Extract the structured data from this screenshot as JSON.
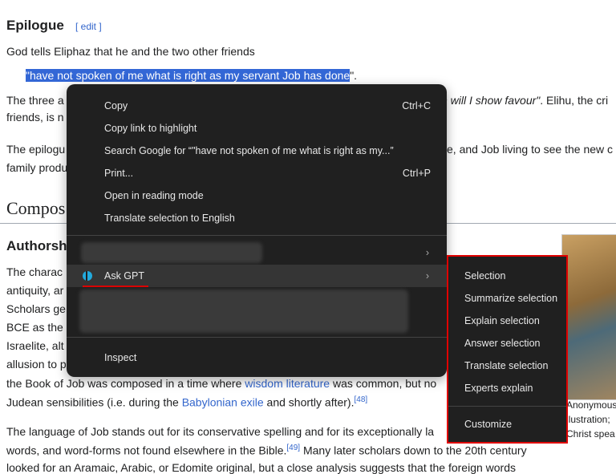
{
  "article": {
    "epilogue_heading": "Epilogue",
    "edit_label": "[ edit ]",
    "p1": "God tells Eliphaz that he and the two other friends",
    "quote": "\"have not spoken of me what is right as my servant Job has done",
    "quote_end": "\".",
    "p2a": "The three a",
    "p2b": "n will I show favour\"",
    "p2c": ". Elihu, the cri",
    "p2d": "friends, is n",
    "p3a": "The epilogu",
    "p3b": "e, and Job living to see the new c",
    "p3c": "family produ",
    "composition_heading": "Compos",
    "authorship_heading": "Authorsh",
    "p4": [
      "The charac",
      "antiquity, ar",
      "Scholars ge",
      "BCE as the",
      "Israelite, alt",
      "allusion to p"
    ],
    "p5a": "the Book of Job was composed in a time where ",
    "p5link": "wisdom literature",
    "p5b": " was common, but no",
    "p6a": "Judean sensibilities (i.e. during the ",
    "p6link": "Babylonian exile",
    "p6b": " and shortly after).",
    "p6ref": "[48]",
    "p7a": "The language of Job stands out for its conservative spelling and for its exceptionally la",
    "p8a": "words, and word-forms not found elsewhere in the Bible.",
    "p8ref": "[49]",
    "p8b": " Many later scholars down to the 20th century",
    "p9": "looked for an Aramaic, Arabic, or Edomite original, but a close analysis suggests that the foreign words",
    "caption": [
      "Anonymous",
      "llustration;",
      "Christ spea"
    ]
  },
  "context_menu": {
    "items": [
      {
        "label": "Copy",
        "shortcut": "Ctrl+C"
      },
      {
        "label": "Copy link to highlight",
        "shortcut": ""
      },
      {
        "label": "Search Google for “\"have not spoken of me what is right as my...”",
        "shortcut": ""
      },
      {
        "label": "Print...",
        "shortcut": "Ctrl+P"
      },
      {
        "label": "Open in reading mode",
        "shortcut": ""
      },
      {
        "label": "Translate selection to English",
        "shortcut": ""
      }
    ],
    "ask_gpt": "Ask GPT",
    "chevron": "›",
    "inspect": "Inspect"
  },
  "submenu": {
    "items": [
      "Selection",
      "Summarize selection",
      "Explain selection",
      "Answer selection",
      "Translate selection",
      "Experts explain"
    ],
    "customize": "Customize"
  },
  "colors": {
    "highlight_border": "#e00000",
    "menu_bg": "#202020",
    "selection": "#3367d6",
    "link": "#3366cc"
  }
}
